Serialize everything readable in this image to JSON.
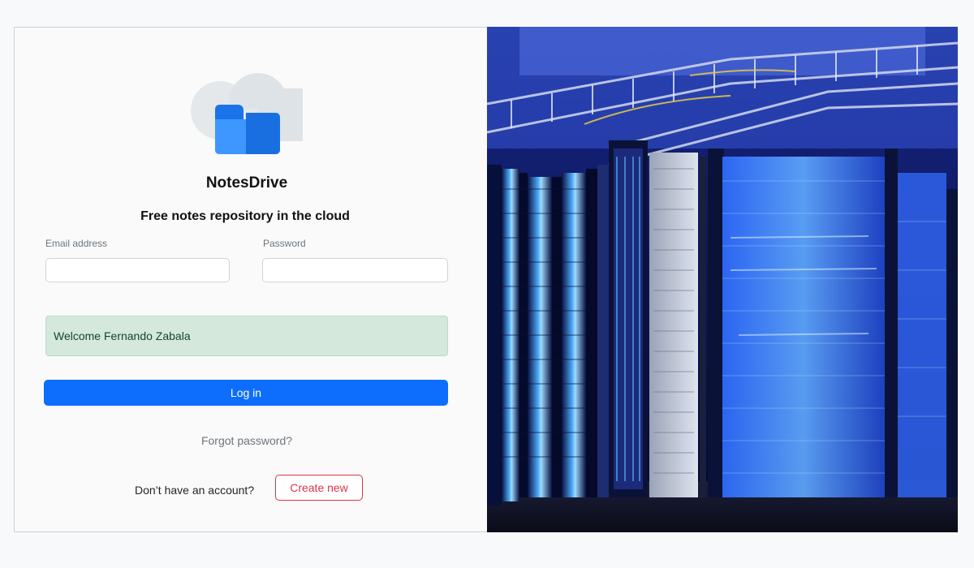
{
  "app": {
    "name": "NotesDrive",
    "tagline": "Free notes repository in the cloud"
  },
  "form": {
    "email_label": "Email address",
    "email_value": "",
    "password_label": "Password",
    "password_value": ""
  },
  "alert": {
    "message": "Welcome Fernando Zabala"
  },
  "actions": {
    "login_label": "Log in",
    "forgot_label": "Forgot password?",
    "no_account_text": "Don’t have an account?",
    "create_label": "Create new"
  },
  "icons": {
    "logo": "cloud-folder-icon"
  },
  "colors": {
    "primary": "#0d6efd",
    "danger": "#dc3545",
    "success_bg": "#d4e8dc",
    "success_text": "#14462d"
  }
}
